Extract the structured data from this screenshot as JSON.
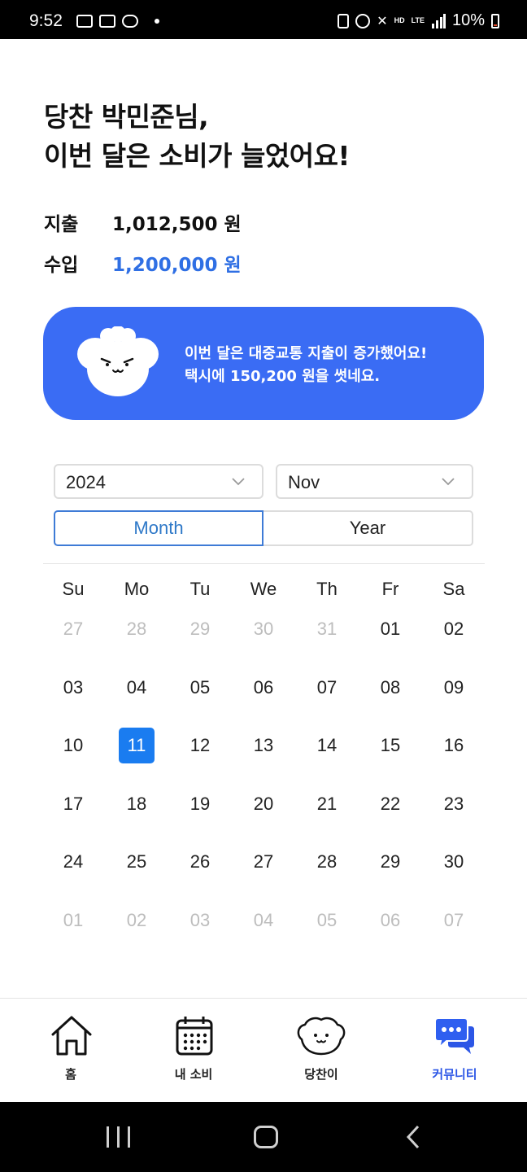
{
  "status_bar": {
    "time": "9:52",
    "hd_voice": "HD",
    "lte": "LTE",
    "battery": "10%"
  },
  "header": {
    "greeting_line1": "당찬 박민준님,",
    "greeting_line2": "이번 달은 소비가 늘었어요!"
  },
  "summary": {
    "expense_label": "지출",
    "expense_value": "1,012,500 원",
    "income_label": "수입",
    "income_value": "1,200,000 원"
  },
  "banner": {
    "line1": "이번 달은 대중교통 지출이 증가했어요!",
    "line2": "택시에 150,200 원을 썻네요."
  },
  "filters": {
    "year_value": "2024",
    "month_value": "Nov",
    "tab_month": "Month",
    "tab_year": "Year",
    "active_tab": "Month"
  },
  "calendar": {
    "weekdays": [
      "Su",
      "Mo",
      "Tu",
      "We",
      "Th",
      "Fr",
      "Sa"
    ],
    "selected_day": "11",
    "weeks": [
      [
        {
          "d": "27",
          "m": true
        },
        {
          "d": "28",
          "m": true
        },
        {
          "d": "29",
          "m": true
        },
        {
          "d": "30",
          "m": true
        },
        {
          "d": "31",
          "m": true
        },
        {
          "d": "01",
          "m": false
        },
        {
          "d": "02",
          "m": false
        }
      ],
      [
        {
          "d": "03",
          "m": false
        },
        {
          "d": "04",
          "m": false
        },
        {
          "d": "05",
          "m": false
        },
        {
          "d": "06",
          "m": false
        },
        {
          "d": "07",
          "m": false
        },
        {
          "d": "08",
          "m": false
        },
        {
          "d": "09",
          "m": false
        }
      ],
      [
        {
          "d": "10",
          "m": false
        },
        {
          "d": "11",
          "m": false
        },
        {
          "d": "12",
          "m": false
        },
        {
          "d": "13",
          "m": false
        },
        {
          "d": "14",
          "m": false
        },
        {
          "d": "15",
          "m": false
        },
        {
          "d": "16",
          "m": false
        }
      ],
      [
        {
          "d": "17",
          "m": false
        },
        {
          "d": "18",
          "m": false
        },
        {
          "d": "19",
          "m": false
        },
        {
          "d": "20",
          "m": false
        },
        {
          "d": "21",
          "m": false
        },
        {
          "d": "22",
          "m": false
        },
        {
          "d": "23",
          "m": false
        }
      ],
      [
        {
          "d": "24",
          "m": false
        },
        {
          "d": "25",
          "m": false
        },
        {
          "d": "26",
          "m": false
        },
        {
          "d": "27",
          "m": false
        },
        {
          "d": "28",
          "m": false
        },
        {
          "d": "29",
          "m": false
        },
        {
          "d": "30",
          "m": false
        }
      ],
      [
        {
          "d": "01",
          "m": true
        },
        {
          "d": "02",
          "m": true
        },
        {
          "d": "03",
          "m": true
        },
        {
          "d": "04",
          "m": true
        },
        {
          "d": "05",
          "m": true
        },
        {
          "d": "06",
          "m": true
        },
        {
          "d": "07",
          "m": true
        }
      ]
    ]
  },
  "bottom_nav": {
    "items": [
      {
        "label": "홈",
        "icon": "home-icon"
      },
      {
        "label": "내 소비",
        "icon": "calendar-icon"
      },
      {
        "label": "당찬이",
        "icon": "mascot-icon"
      },
      {
        "label": "커뮤니티",
        "icon": "chat-icon"
      }
    ],
    "active": "커뮤니티"
  },
  "colors": {
    "accent": "#3a6cf4",
    "income": "#2f6fe4",
    "selected_day": "#1a7cf0",
    "active_tab": "#3e7bd6",
    "nav_active": "#2c56e6"
  }
}
